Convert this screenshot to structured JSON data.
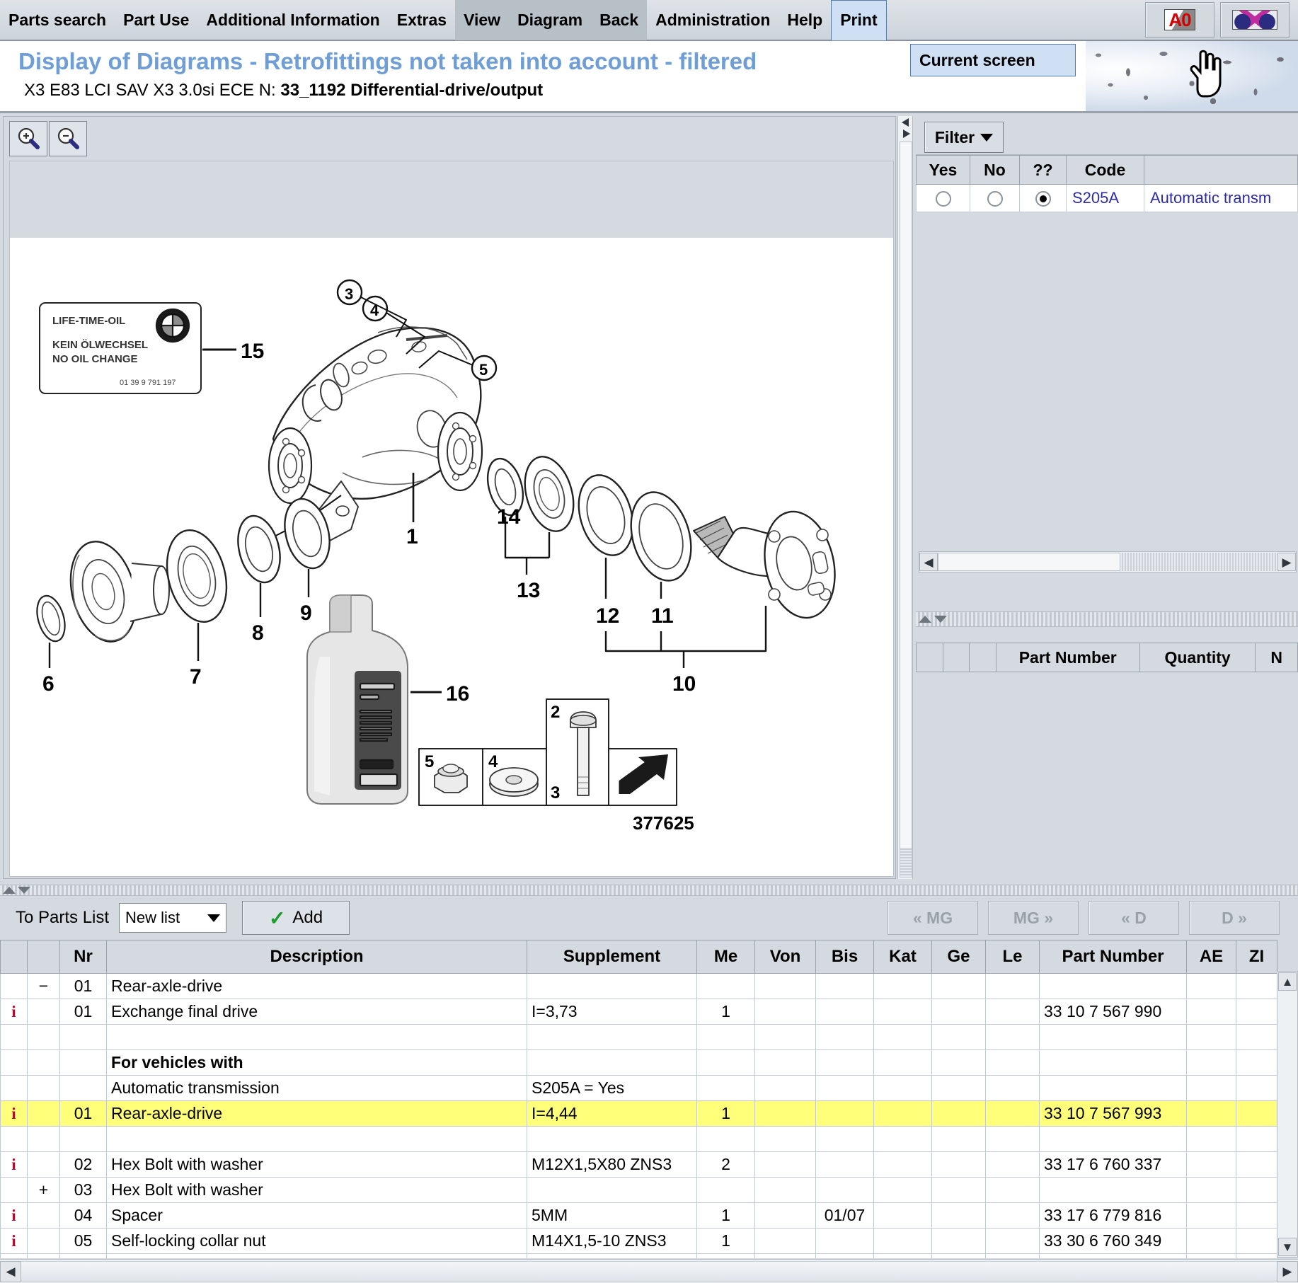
{
  "menu": {
    "items": [
      {
        "label": "Parts search",
        "state": "normal"
      },
      {
        "label": "Part Use",
        "state": "normal"
      },
      {
        "label": "Additional Information",
        "state": "normal"
      },
      {
        "label": "Extras",
        "state": "normal"
      },
      {
        "label": "View",
        "state": "hover"
      },
      {
        "label": "Diagram",
        "state": "hover"
      },
      {
        "label": "Back",
        "state": "hover"
      },
      {
        "label": "Administration",
        "state": "normal"
      },
      {
        "label": "Help",
        "state": "normal"
      },
      {
        "label": "Print",
        "state": "open"
      }
    ],
    "dropdown": {
      "open_for": "Print",
      "items": [
        "Current screen"
      ]
    },
    "toolbar_icons": [
      "warning-a0-icon",
      "crossed-cars-icon"
    ]
  },
  "title": {
    "main": "Display of Diagrams - Retrofittings not taken into account - filtered",
    "sub_prefix": "X3 E83 LCI SAV X3 3.0si ECE  N: ",
    "sub_bold": "33_1192 Differential-drive/output"
  },
  "diagram": {
    "zoom_in_label": "zoom-in",
    "zoom_out_label": "zoom-out",
    "drawing_number": "377625",
    "oil_label": {
      "line1": "LIFE-TIME-OIL",
      "line2": "KEIN ÖLWECHSEL",
      "line3": "NO OIL CHANGE",
      "part_code": "01 39 9 791 197"
    },
    "callouts": [
      "1",
      "2",
      "3",
      "4",
      "5",
      "6",
      "7",
      "8",
      "9",
      "10",
      "11",
      "12",
      "13",
      "14",
      "15",
      "16"
    ],
    "inset_numbers": [
      "5",
      "4",
      "2",
      "3"
    ]
  },
  "right_panel": {
    "filter_button": "Filter",
    "code_table": {
      "headers": [
        "Yes",
        "No",
        "??",
        "Code",
        ""
      ],
      "rows": [
        {
          "yes": false,
          "no": false,
          "unknown": true,
          "code": "S205A",
          "description": "Automatic transm"
        }
      ]
    },
    "part_table": {
      "headers": [
        "",
        "",
        "",
        "Part Number",
        "Quantity",
        "N"
      ],
      "rows": []
    }
  },
  "bottom": {
    "to_parts_list_label": "To Parts List",
    "list_select_value": "New list",
    "add_button": "Add",
    "nav_buttons": [
      "« MG",
      "MG »",
      "« D",
      "D »"
    ],
    "table": {
      "headers": [
        "",
        "",
        "Nr",
        "Description",
        "Supplement",
        "Me",
        "Von",
        "Bis",
        "Kat",
        "Ge",
        "Le",
        "Part Number",
        "AE",
        "ZI"
      ],
      "rows": [
        {
          "info": "",
          "tree": "−",
          "nr": "01",
          "description": "Rear-axle-drive",
          "supplement": "",
          "me": "",
          "von": "",
          "bis": "",
          "kat": "",
          "ge": "",
          "le": "",
          "part_number": "",
          "ae": "",
          "zi": "",
          "bold": false,
          "highlight": false
        },
        {
          "info": "i",
          "tree": "",
          "nr": "01",
          "description": "Exchange final drive",
          "supplement": "I=3,73",
          "me": "1",
          "von": "",
          "bis": "",
          "kat": "",
          "ge": "",
          "le": "",
          "part_number": "33 10 7 567 990",
          "ae": "",
          "zi": "",
          "bold": false,
          "highlight": false
        },
        {
          "info": "",
          "tree": "",
          "nr": "",
          "description": "",
          "supplement": "",
          "me": "",
          "von": "",
          "bis": "",
          "kat": "",
          "ge": "",
          "le": "",
          "part_number": "",
          "ae": "",
          "zi": "",
          "bold": false,
          "highlight": false
        },
        {
          "info": "",
          "tree": "",
          "nr": "",
          "description": "For vehicles with",
          "supplement": "",
          "me": "",
          "von": "",
          "bis": "",
          "kat": "",
          "ge": "",
          "le": "",
          "part_number": "",
          "ae": "",
          "zi": "",
          "bold": true,
          "highlight": false
        },
        {
          "info": "",
          "tree": "",
          "nr": "",
          "description": "Automatic transmission",
          "supplement": "S205A = Yes",
          "me": "",
          "von": "",
          "bis": "",
          "kat": "",
          "ge": "",
          "le": "",
          "part_number": "",
          "ae": "",
          "zi": "",
          "bold": false,
          "highlight": false
        },
        {
          "info": "i",
          "tree": "",
          "nr": "01",
          "description": "Rear-axle-drive",
          "supplement": "I=4,44",
          "me": "1",
          "von": "",
          "bis": "",
          "kat": "",
          "ge": "",
          "le": "",
          "part_number": "33 10 7 567 993",
          "ae": "",
          "zi": "",
          "bold": false,
          "highlight": true
        },
        {
          "info": "",
          "tree": "",
          "nr": "",
          "description": "",
          "supplement": "",
          "me": "",
          "von": "",
          "bis": "",
          "kat": "",
          "ge": "",
          "le": "",
          "part_number": "",
          "ae": "",
          "zi": "",
          "bold": false,
          "highlight": false
        },
        {
          "info": "i",
          "tree": "",
          "nr": "02",
          "description": "Hex Bolt with washer",
          "supplement": "M12X1,5X80 ZNS3",
          "me": "2",
          "von": "",
          "bis": "",
          "kat": "",
          "ge": "",
          "le": "",
          "part_number": "33 17 6 760 337",
          "ae": "",
          "zi": "",
          "bold": false,
          "highlight": false
        },
        {
          "info": "",
          "tree": "+",
          "nr": "03",
          "description": "Hex Bolt with washer",
          "supplement": "",
          "me": "",
          "von": "",
          "bis": "",
          "kat": "",
          "ge": "",
          "le": "",
          "part_number": "",
          "ae": "",
          "zi": "",
          "bold": false,
          "highlight": false
        },
        {
          "info": "i",
          "tree": "",
          "nr": "04",
          "description": "Spacer",
          "supplement": "5MM",
          "me": "1",
          "von": "",
          "bis": "01/07",
          "kat": "",
          "ge": "",
          "le": "",
          "part_number": "33 17 6 779 816",
          "ae": "",
          "zi": "",
          "bold": false,
          "highlight": false
        },
        {
          "info": "i",
          "tree": "",
          "nr": "05",
          "description": "Self-locking collar nut",
          "supplement": "M14X1,5-10 ZNS3",
          "me": "1",
          "von": "",
          "bis": "",
          "kat": "",
          "ge": "",
          "le": "",
          "part_number": "33 30 6 760 349",
          "ae": "",
          "zi": "",
          "bold": false,
          "highlight": false
        },
        {
          "info": "",
          "tree": "",
          "nr": "",
          "description": "",
          "supplement": "",
          "me": "",
          "von": "",
          "bis": "",
          "kat": "",
          "ge": "",
          "le": "",
          "part_number": "",
          "ae": "",
          "zi": "",
          "bold": false,
          "highlight": false
        }
      ]
    }
  },
  "colors": {
    "title_blue": "#6f9ed6",
    "highlight_yellow": "#ffff7a",
    "link_blue": "#2b2ba8",
    "panel_grey": "#d4dae0",
    "info_red": "#b01030"
  }
}
